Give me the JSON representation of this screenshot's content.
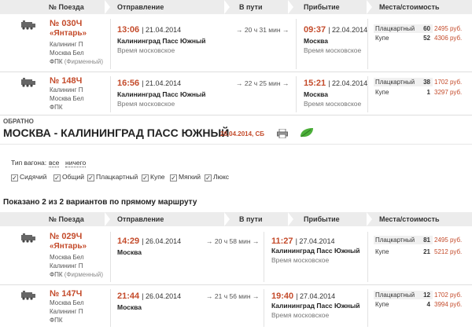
{
  "header": {
    "num": "№ Поезда",
    "dep": "Отправление",
    "way": "В пути",
    "arr": "Прибытие",
    "seats": "Места/стоимость"
  },
  "trains_forward": [
    {
      "num": "№ 030Ч",
      "name": "«Янтарь»",
      "from": "Калининг П",
      "to": "Москва Бел",
      "carrier": "ФПК",
      "firm": "(Фирменный)",
      "dep_time": "13:06",
      "dep_date": "| 21.04.2014",
      "dep_station": "Калининград Пасс Южный",
      "dep_tz": "Время московское",
      "duration": "20 ч 31 мин",
      "arr_time": "09:37",
      "arr_date": "| 22.04.2014",
      "arr_station": "Москва",
      "arr_tz": "Время московское",
      "seats": [
        {
          "type": "Плацкартный",
          "count": "60",
          "price": "2495 руб."
        },
        {
          "type": "Купе",
          "count": "52",
          "price": "4306 руб."
        }
      ]
    },
    {
      "num": "№ 148Ч",
      "name": "",
      "from": "Калининг П",
      "to": "Москва Бел",
      "carrier": "ФПК",
      "firm": "",
      "dep_time": "16:56",
      "dep_date": "| 21.04.2014",
      "dep_station": "Калининград Пасс Южный",
      "dep_tz": "Время московское",
      "duration": "22 ч 25 мин",
      "arr_time": "15:21",
      "arr_date": "| 22.04.2014",
      "arr_station": "Москва",
      "arr_tz": "Время московское",
      "seats": [
        {
          "type": "Плацкартный",
          "count": "38",
          "price": "1702 руб."
        },
        {
          "type": "Купе",
          "count": "1",
          "price": "3297 руб."
        }
      ]
    }
  ],
  "back": {
    "label": "ОБРАТНО",
    "route": "МОСКВА - КАЛИНИНГРАД ПАСС ЮЖНЫЙ",
    "date": "26.04.2014, СБ"
  },
  "filter": {
    "label": "Тип вагона:",
    "all": "все",
    "none": "ничего",
    "types": [
      {
        "label": "Сидячий",
        "checked": true
      },
      {
        "label": "Общий",
        "checked": true
      },
      {
        "label": "Плацкартный",
        "checked": true
      },
      {
        "label": "Купе",
        "checked": true
      },
      {
        "label": "Мягкий",
        "checked": true
      },
      {
        "label": "Люкс",
        "checked": true
      }
    ]
  },
  "shown_text": "Показано 2 из 2 вариантов по прямому маршруту",
  "trains_back": [
    {
      "num": "№ 029Ч",
      "name": "«Янтарь»",
      "from": "Москва Бел",
      "to": "Калининг П",
      "carrier": "ФПК",
      "firm": "(Фирменный)",
      "dep_time": "14:29",
      "dep_date": "| 26.04.2014",
      "dep_station": "Москва",
      "dep_tz": "",
      "duration": "20 ч 58 мин",
      "arr_time": "11:27",
      "arr_date": "| 27.04.2014",
      "arr_station": "Калининград Пасс Южный",
      "arr_tz": "Время московское",
      "seats": [
        {
          "type": "Плацкартный",
          "count": "81",
          "price": "2495 руб."
        },
        {
          "type": "Купе",
          "count": "21",
          "price": "5212 руб."
        }
      ]
    },
    {
      "num": "№ 147Ч",
      "name": "",
      "from": "Москва Бел",
      "to": "Калининг П",
      "carrier": "ФПК",
      "firm": "",
      "dep_time": "21:44",
      "dep_date": "| 26.04.2014",
      "dep_station": "Москва",
      "dep_tz": "",
      "duration": "21 ч 56 мин",
      "arr_time": "19:40",
      "arr_date": "| 27.04.2014",
      "arr_station": "Калининград Пасс Южный",
      "arr_tz": "Время московское",
      "seats": [
        {
          "type": "Плацкартный",
          "count": "12",
          "price": "1702 руб."
        },
        {
          "type": "Купе",
          "count": "4",
          "price": "3994 руб."
        }
      ]
    }
  ],
  "colors": {
    "accent": "#c44b2b",
    "header_bg": "#ececec",
    "green": "#3a9a2a"
  },
  "icons": {
    "train": "train-icon",
    "print": "print-icon",
    "leaf": "eco-leaf-icon"
  }
}
